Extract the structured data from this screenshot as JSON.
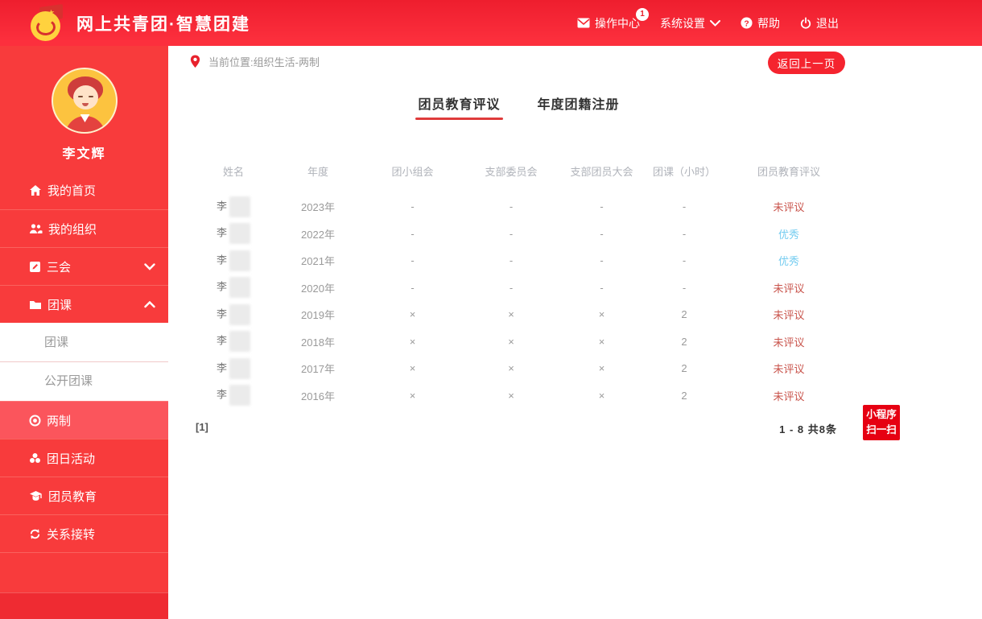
{
  "header": {
    "title": "网上共青团·智慧团建",
    "nav": {
      "action_center": "操作中心",
      "action_center_badge": "1",
      "settings": "系统设置",
      "help": "帮助",
      "logout": "退出"
    }
  },
  "sidebar": {
    "username": "李文辉",
    "items": [
      {
        "label": "我的首页",
        "icon": "home-icon"
      },
      {
        "label": "我的组织",
        "icon": "group-icon"
      },
      {
        "label": "三会",
        "icon": "edit-icon",
        "state": "collapsed"
      },
      {
        "label": "团课",
        "icon": "folder-icon",
        "state": "expanded"
      },
      {
        "label": "两制",
        "icon": "target-icon",
        "selected": true
      },
      {
        "label": "团日活动",
        "icon": "activity-icon"
      },
      {
        "label": "团员教育",
        "icon": "education-icon"
      },
      {
        "label": "关系接转",
        "icon": "transfer-icon"
      }
    ],
    "submenu": [
      {
        "label": "团课"
      },
      {
        "label": "公开团课"
      }
    ]
  },
  "main": {
    "breadcrumb": "当前位置:组织生活-两制",
    "back_button": "返回上一页",
    "tabs": [
      {
        "label": "团员教育评议",
        "active": true
      },
      {
        "label": "年度团籍注册",
        "active": false
      }
    ],
    "table": {
      "headers": [
        "姓名",
        "年度",
        "团小组会",
        "支部委员会",
        "支部团员大会",
        "团课（小时）",
        "团员教育评议"
      ],
      "redacted_name_prefix": "李",
      "rows": [
        {
          "cells": [
            "李",
            "2023年",
            "-",
            "-",
            "-",
            "-"
          ],
          "evaluation": "未评议",
          "status": "pending"
        },
        {
          "cells": [
            "李",
            "2022年",
            "-",
            "-",
            "-",
            "-"
          ],
          "evaluation": "优秀",
          "status": "excellent"
        },
        {
          "cells": [
            "李",
            "2021年",
            "-",
            "-",
            "-",
            "-"
          ],
          "evaluation": "优秀",
          "status": "excellent"
        },
        {
          "cells": [
            "李",
            "2020年",
            "-",
            "-",
            "-",
            "-"
          ],
          "evaluation": "未评议",
          "status": "pending"
        },
        {
          "cells": [
            "李",
            "2019年",
            "×",
            "×",
            "×",
            "2"
          ],
          "evaluation": "未评议",
          "status": "pending"
        },
        {
          "cells": [
            "李",
            "2018年",
            "×",
            "×",
            "×",
            "2"
          ],
          "evaluation": "未评议",
          "status": "pending"
        },
        {
          "cells": [
            "李",
            "2017年",
            "×",
            "×",
            "×",
            "2"
          ],
          "evaluation": "未评议",
          "status": "pending"
        },
        {
          "cells": [
            "李",
            "2016年",
            "×",
            "×",
            "×",
            "2"
          ],
          "evaluation": "未评议",
          "status": "pending"
        }
      ]
    },
    "pagination": {
      "page": "[1]",
      "summary": "1 - 8  共8条"
    },
    "mini_program": {
      "line1": "小程序",
      "line2": "扫一扫"
    }
  },
  "colors": {
    "header_red_top": "#ee1e2e",
    "header_red_bottom": "#fc2f3d",
    "sidebar_red": "#f83b3c",
    "selected_item_red": "#fb555c",
    "accent_red": "#f5242f",
    "tab_underline": "#df3b3b",
    "eval_pending": "#c9544c",
    "eval_excellent": "#74ccf0",
    "badge_red": "#e60012",
    "logo_yellow": "#ffd23e"
  }
}
